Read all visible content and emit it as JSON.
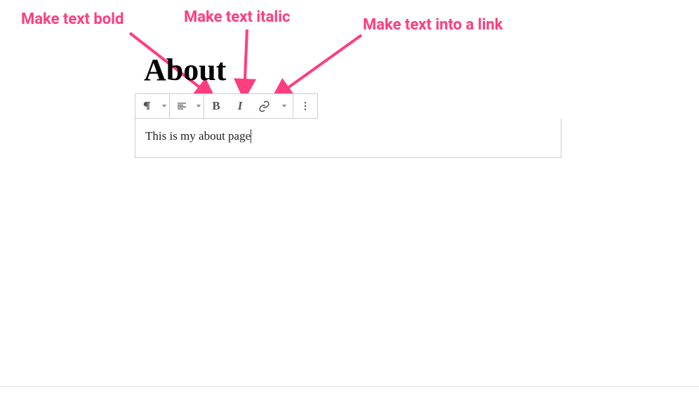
{
  "annotations": {
    "bold": "Make text bold",
    "italic": "Make text italic",
    "link": "Make text into a link"
  },
  "page": {
    "title": "About"
  },
  "editor": {
    "content": "This is my about page"
  },
  "toolbar": {
    "paragraph": "¶",
    "align": "≡",
    "bold": "B",
    "italic": "I",
    "link": "🔗",
    "more": "⋮"
  },
  "colors": {
    "annotation": "#ff3d7f",
    "border": "#cccccc",
    "icon": "#555555"
  }
}
